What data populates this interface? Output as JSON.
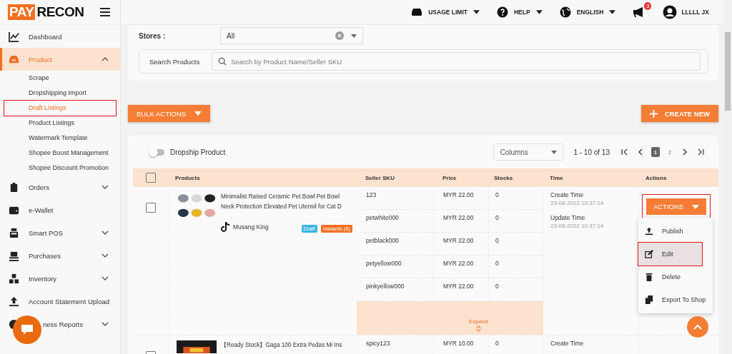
{
  "brand": {
    "logo_left": "PAY",
    "logo_right": "RECON"
  },
  "topbar": {
    "items": [
      {
        "label": "USAGE LIMIT"
      },
      {
        "label": "HELP"
      },
      {
        "label": "ENGLISH"
      }
    ],
    "notification_badge": "3",
    "user": "LLLLL JX"
  },
  "sidebar": {
    "items": [
      {
        "label": "Dashboard",
        "selected": false
      },
      {
        "label": "Product",
        "selected": true,
        "expanded": true,
        "children": [
          {
            "label": "Scrape",
            "selected": false,
            "highlighted": false
          },
          {
            "label": "Dropshipping Import",
            "selected": false,
            "highlighted": false
          },
          {
            "label": "Draft Listings",
            "selected": true,
            "highlighted": true
          },
          {
            "label": "Product Listings",
            "selected": false,
            "highlighted": false
          },
          {
            "label": "Watermark Template",
            "selected": false,
            "highlighted": false
          },
          {
            "label": "Shopee Boost Management",
            "selected": false,
            "highlighted": false
          },
          {
            "label": "Shopee Discount Promotion",
            "selected": false,
            "highlighted": false
          }
        ]
      },
      {
        "label": "Orders",
        "selected": false,
        "expanded": false
      },
      {
        "label": "e-Wallet",
        "selected": false
      },
      {
        "label": "Smart POS",
        "selected": false,
        "expanded": false
      },
      {
        "label": "Purchases",
        "selected": false,
        "expanded": false
      },
      {
        "label": "Inventory",
        "selected": false,
        "expanded": false
      },
      {
        "label": "Account Statement Upload",
        "selected": false
      },
      {
        "label": "ness Reports",
        "selected": false,
        "expanded": false
      }
    ]
  },
  "filters": {
    "stores_label": "Stores :",
    "stores_value": "All",
    "search_label": "Search Products",
    "search_placeholder": "Search by Product Name/Seller SKU"
  },
  "bulk_button": "BULK ACTIONS",
  "create_button": "CREATE NEW",
  "toolbar": {
    "toggle_label": "Dropship Product",
    "toggle_on": false,
    "columns_placeholder": "Columns",
    "range": "1 - 10 of 13",
    "pages": [
      {
        "label": "1",
        "selected": true
      },
      {
        "label": "2",
        "selected": false
      }
    ]
  },
  "table": {
    "header_checked": false,
    "columns": [
      "Products",
      "Seller SKU",
      "Price",
      "Stocks",
      "Time",
      "Actions"
    ],
    "rows": [
      {
        "checked": false,
        "title": "Minimalist Raised Ceramic Pet Bowl Pet Bowl Neck Protection Elevated Pet Utensil for Cat D",
        "shop": "Musang King",
        "tags": [
          {
            "label": "Draft",
            "color": "#3cb4e6"
          },
          {
            "label": "Variants (8)",
            "color": "#f26f22"
          }
        ],
        "variants": [
          {
            "sku": "123",
            "price": "MYR 22.00",
            "stock": "0"
          },
          {
            "sku": "petwhite000",
            "price": "MYR 22.00",
            "stock": "0"
          },
          {
            "sku": "petblack000",
            "price": "MYR 22.00",
            "stock": "0"
          },
          {
            "sku": "petyellow000",
            "price": "MYR 22.00",
            "stock": "0"
          },
          {
            "sku": "pinkyellow000",
            "price": "MYR 22.00",
            "stock": "0"
          }
        ],
        "expand": "Expand",
        "times": [
          {
            "label": "Create Time",
            "value": "23-08-2022 10:37:14"
          },
          {
            "label": "Update Time",
            "value": "23-08-2022 10:37:14"
          }
        ],
        "action": {
          "label": "ACTIONS",
          "highlighted": true
        }
      },
      {
        "checked": false,
        "title": "【Ready Stock】Gaga 100 Extra Pedas Mi Ins",
        "variants": [
          {
            "sku": "spicy123",
            "price": "MYR 10.00",
            "stock": "0"
          }
        ],
        "times": [
          {
            "label": "Create Time"
          }
        ]
      }
    ]
  },
  "action_menu": [
    {
      "label": "Publish",
      "selected": false,
      "highlighted": false
    },
    {
      "label": "Edit",
      "selected": true,
      "highlighted": true
    },
    {
      "label": "Delete",
      "selected": false,
      "highlighted": false
    },
    {
      "label": "Export To Shop",
      "selected": false,
      "highlighted": false
    }
  ]
}
